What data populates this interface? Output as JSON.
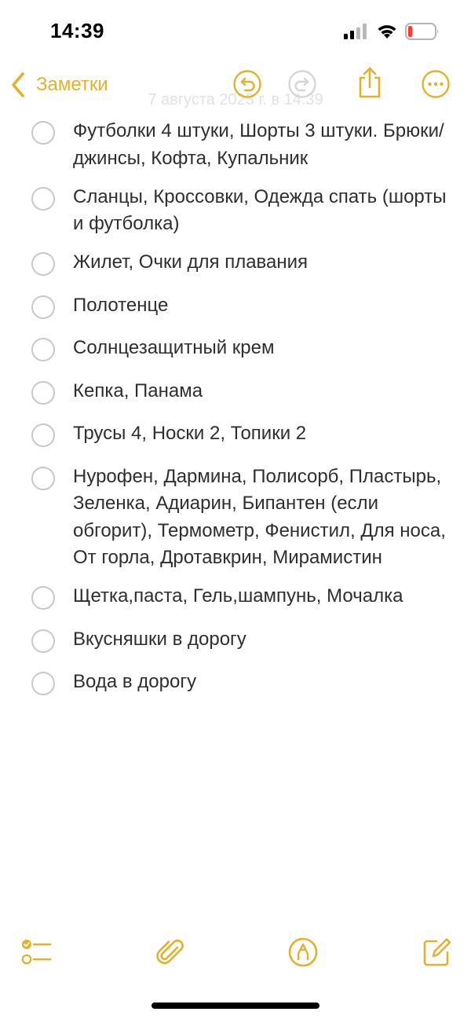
{
  "status_bar": {
    "time": "14:39",
    "battery_level": 0.15,
    "battery_color": "#ff3b30"
  },
  "nav": {
    "back_label": "Заметки",
    "date_overlay": "7 августа 2023 г. в 14:39",
    "accent_color": "#e2b12b",
    "icons": [
      "chevron-left-icon",
      "undo-icon",
      "redo-icon",
      "share-icon",
      "more-icon"
    ]
  },
  "checklist": {
    "items": [
      {
        "text": "Футболки 4 штуки, Шорты 3 штуки. Брюки/джинсы, Кофта, Купальник",
        "checked": false
      },
      {
        "text": "Сланцы, Кроссовки, Одежда спать (шорты и футболка)",
        "checked": false
      },
      {
        "text": "Жилет, Очки для плавания",
        "checked": false
      },
      {
        "text": "Полотенце",
        "checked": false
      },
      {
        "text": "Солнцезащитный крем",
        "checked": false
      },
      {
        "text": "Кепка, Панама",
        "checked": false
      },
      {
        "text": "Трусы 4, Носки 2, Топики 2",
        "checked": false
      },
      {
        "text": "Нурофен, Дармина, Полисорб, Пластырь, Зеленка, Адиарин, Бипантен (если обгорит), Термометр, Фенистил, Для носа, От горла, Дротавкрин, Мирамистин",
        "checked": false
      },
      {
        "text": "Щетка,паста, Гель,шампунь, Мочалка",
        "checked": false
      },
      {
        "text": "Вкусняшки в дорогу",
        "checked": false
      },
      {
        "text": "Вода в дорогу",
        "checked": false
      }
    ]
  },
  "toolbar": {
    "icons": [
      "checklist-icon",
      "paperclip-icon",
      "markup-pen-icon",
      "compose-icon"
    ]
  }
}
